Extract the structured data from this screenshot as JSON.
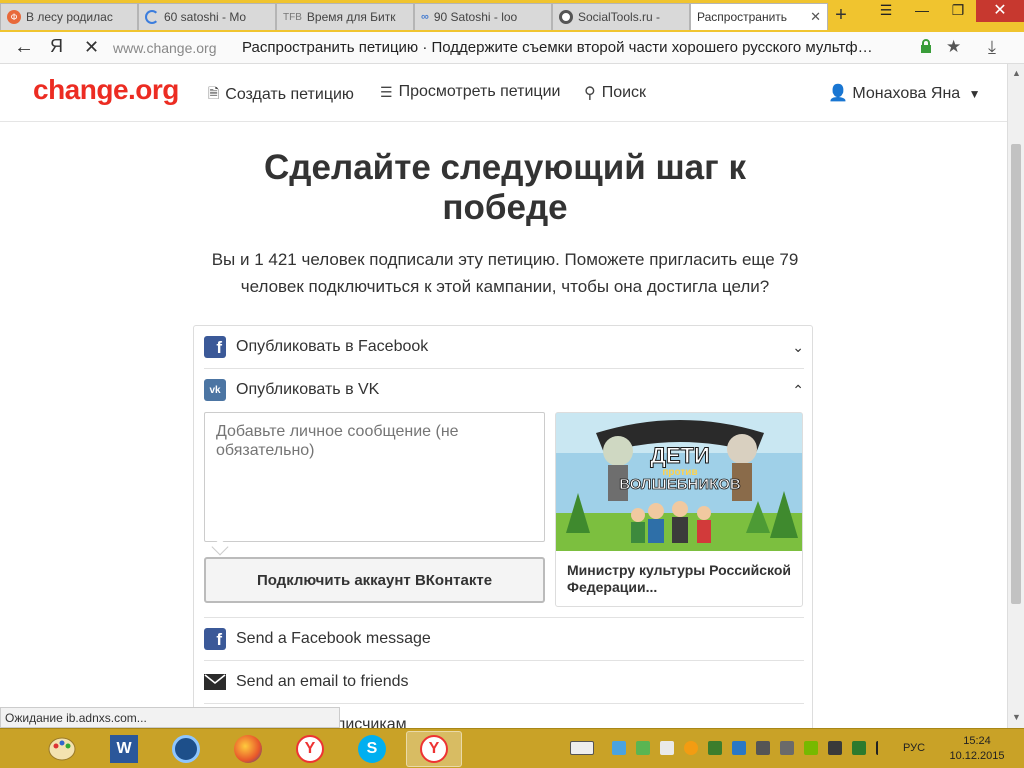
{
  "browser": {
    "tabs": [
      {
        "label": "В лесу родилас",
        "icon_color": "#e8693a"
      },
      {
        "label": "60 satoshi - Mo",
        "icon_color": "#3b7ddd"
      },
      {
        "label": "Время для Битк",
        "icon_color": "#777777"
      },
      {
        "label": "90 Satoshi - loo",
        "icon_color": "#4a7fd0"
      },
      {
        "label": "SocialTools.ru -",
        "icon_color": "#555555"
      },
      {
        "label": "Распространить",
        "icon_color": "#ffffff"
      }
    ],
    "tab_letters": {
      "first": "Ф",
      "third": "TFB"
    },
    "new_tab": "+",
    "address": {
      "logo": "Я",
      "url": "www.change.org",
      "title": "Распространить петицию · Поддержите съемки второй части хорошего русского мультф…"
    }
  },
  "site": {
    "logo": "change.org",
    "brand_color": "#ec2c22",
    "nav": {
      "create": "Создать петицию",
      "browse": "Просмотреть петиции",
      "search": "Поиск"
    },
    "user": "Монахова Яна"
  },
  "main": {
    "headline": "Сделайте следующий шаг к победе",
    "subtext": "Вы и 1 421 человек подписали эту петицию. Поможете пригласить еще 79 человек подключиться к этой кампании, чтобы она достигла цели?",
    "share": {
      "facebook_post": "Опубликовать в Facebook",
      "vk_post": "Опубликовать в VK",
      "vk_icon_text": "vk",
      "message_placeholder": "Добавьте личное сообщение (не обязательно)",
      "vk_connect": "Подключить аккаунт ВКонтакте",
      "card_title": "Министру культуры Российской Федерации...",
      "card_image_text_1": "ДЕТИ",
      "card_image_text_2": "против",
      "card_image_text_3": "ВОЛШЕБНИКОВ",
      "facebook_message": "Send a Facebook message",
      "email_friends": "Send an email to friends",
      "next_partial": "лисчикам"
    }
  },
  "status": {
    "text": "Ожидание ib.adnxs.com..."
  },
  "taskbar": {
    "lang": "РУС",
    "time": "15:24",
    "date": "10.12.2015"
  }
}
